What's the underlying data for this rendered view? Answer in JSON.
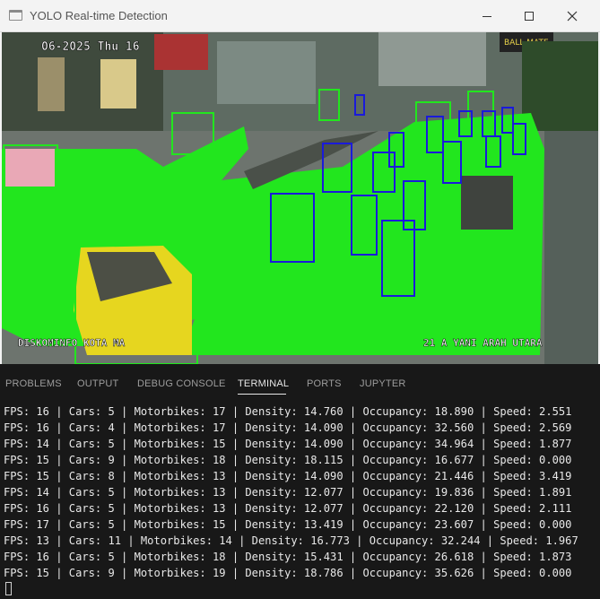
{
  "window": {
    "title": "YOLO Real-time Detection",
    "minimize_icon": "minimize-icon",
    "maximize_icon": "maximize-icon",
    "close_icon": "close-icon"
  },
  "video": {
    "timestamp": "06-2025 Thu 16",
    "overlay_left": "DISKOMINFO KOTA MA",
    "overlay_right": "21  A YANI ARAH UTARA",
    "sign_text": "BALL MATE",
    "colors": {
      "segmentation": "#22e61e",
      "car_box": "#22e61e",
      "motorbike_box": "#1a1adb"
    }
  },
  "panel": {
    "tabs": [
      {
        "label": "PROBLEMS",
        "active": false
      },
      {
        "label": "OUTPUT",
        "active": false
      },
      {
        "label": "DEBUG CONSOLE",
        "active": false
      },
      {
        "label": "TERMINAL",
        "active": true
      },
      {
        "label": "PORTS",
        "active": false
      },
      {
        "label": "JUPYTER",
        "active": false
      }
    ]
  },
  "terminal": {
    "lines": [
      "FPS: 16 | Cars: 5 | Motorbikes: 17 | Density: 14.760 | Occupancy: 18.890 | Speed: 2.551",
      "FPS: 16 | Cars: 4 | Motorbikes: 17 | Density: 14.090 | Occupancy: 32.560 | Speed: 2.569",
      "FPS: 14 | Cars: 5 | Motorbikes: 15 | Density: 14.090 | Occupancy: 34.964 | Speed: 1.877",
      "FPS: 15 | Cars: 9 | Motorbikes: 18 | Density: 18.115 | Occupancy: 16.677 | Speed: 0.000",
      "FPS: 15 | Cars: 8 | Motorbikes: 13 | Density: 14.090 | Occupancy: 21.446 | Speed: 3.419",
      "FPS: 14 | Cars: 5 | Motorbikes: 13 | Density: 12.077 | Occupancy: 19.836 | Speed: 1.891",
      "FPS: 16 | Cars: 5 | Motorbikes: 13 | Density: 12.077 | Occupancy: 22.120 | Speed: 2.111",
      "FPS: 17 | Cars: 5 | Motorbikes: 15 | Density: 13.419 | Occupancy: 23.607 | Speed: 0.000",
      "FPS: 13 | Cars: 11 | Motorbikes: 14 | Density: 16.773 | Occupancy: 32.244 | Speed: 1.967",
      "FPS: 16 | Cars: 5 | Motorbikes: 18 | Density: 15.431 | Occupancy: 26.618 | Speed: 1.873",
      "FPS: 15 | Cars: 9 | Motorbikes: 19 | Density: 18.786 | Occupancy: 35.626 | Speed: 0.000"
    ]
  }
}
